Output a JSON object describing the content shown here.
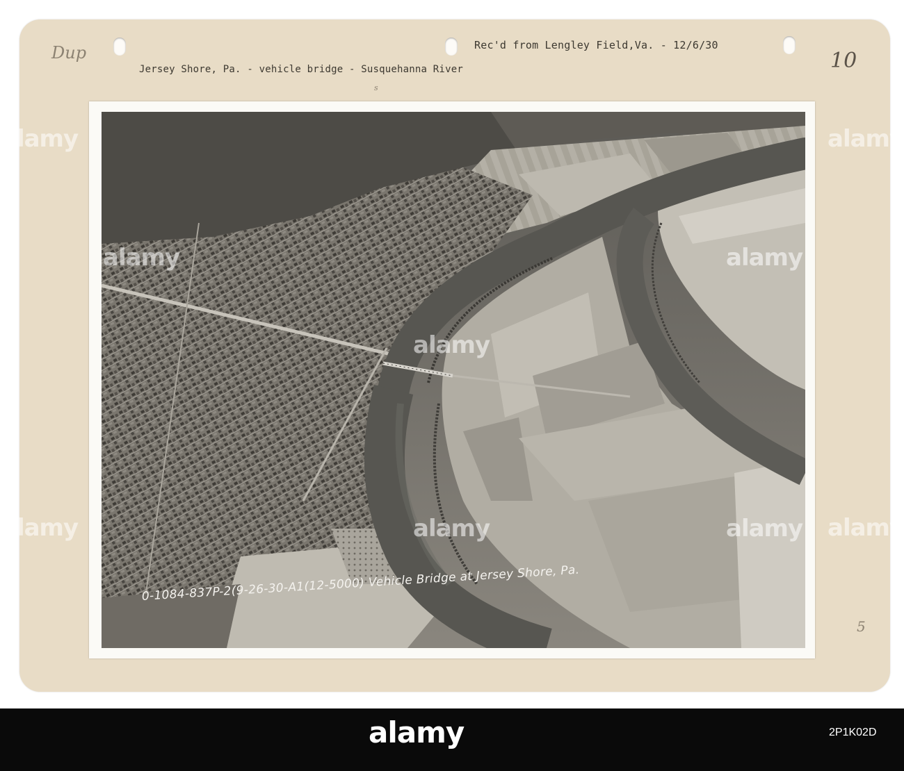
{
  "card": {
    "annotation_top_left": "Dup",
    "received_note": "Rec'd from Lengley Field,Va. - 12/6/30",
    "subject_line": "Jersey Shore, Pa. - vehicle bridge  - Susquehanna River",
    "page_number_top_right": "10",
    "small_mark": "s",
    "page_number_bottom_right": "5"
  },
  "photo": {
    "caption": "0-1084-837P-2(9-26-30-A1(12-5000)  Vehicle Bridge at Jersey Shore, Pa."
  },
  "watermark": {
    "text": "alamy"
  },
  "footer": {
    "logo": "alamy",
    "image_id": "2P1K02D"
  }
}
